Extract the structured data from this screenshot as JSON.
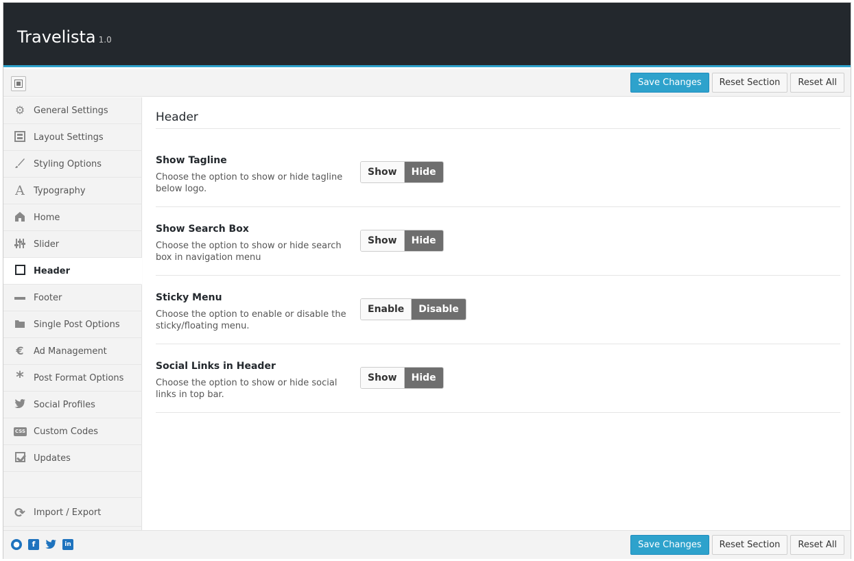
{
  "app": {
    "title": "Travelista",
    "version": "1.0"
  },
  "toolbar": {
    "save_label": "Save Changes",
    "reset_section_label": "Reset Section",
    "reset_all_label": "Reset All"
  },
  "sidebar": {
    "items": [
      {
        "label": "General Settings",
        "icon": "gears-icon"
      },
      {
        "label": "Layout Settings",
        "icon": "layout-icon"
      },
      {
        "label": "Styling Options",
        "icon": "brush-icon"
      },
      {
        "label": "Typography",
        "icon": "typography-icon"
      },
      {
        "label": "Home",
        "icon": "home-icon"
      },
      {
        "label": "Slider",
        "icon": "sliders-icon"
      },
      {
        "label": "Header",
        "icon": "square-icon",
        "active": true
      },
      {
        "label": "Footer",
        "icon": "minus-icon"
      },
      {
        "label": "Single Post Options",
        "icon": "folder-icon"
      },
      {
        "label": "Ad Management",
        "icon": "euro-icon"
      },
      {
        "label": "Post Format Options",
        "icon": "asterisk-icon"
      },
      {
        "label": "Social Profiles",
        "icon": "twitter-icon"
      },
      {
        "label": "Custom Codes",
        "icon": "css-icon"
      },
      {
        "label": "Updates",
        "icon": "checkbox-icon"
      }
    ],
    "import_export": {
      "label": "Import / Export",
      "icon": "refresh-icon"
    }
  },
  "section": {
    "title": "Header",
    "options": [
      {
        "title": "Show Tagline",
        "description": "Choose the option to show or hide tagline below logo.",
        "choices": [
          "Show",
          "Hide"
        ],
        "selected": "Hide"
      },
      {
        "title": "Show Search Box",
        "description": "Choose the option to show or hide search box in navigation menu",
        "choices": [
          "Show",
          "Hide"
        ],
        "selected": "Hide"
      },
      {
        "title": "Sticky Menu",
        "description": "Choose the option to enable or disable the sticky/floating menu.",
        "choices": [
          "Enable",
          "Disable"
        ],
        "selected": "Disable"
      },
      {
        "title": "Social Links in Header",
        "description": "Choose the option to show or hide social links in top bar.",
        "choices": [
          "Show",
          "Hide"
        ],
        "selected": "Hide"
      }
    ]
  },
  "footer": {
    "social_icons": [
      "github-icon",
      "facebook-icon",
      "twitter-icon",
      "linkedin-icon"
    ]
  },
  "colors": {
    "header_bg": "#23282d",
    "accent": "#2ea2cc",
    "toggle_on": "#6e6e6e"
  }
}
